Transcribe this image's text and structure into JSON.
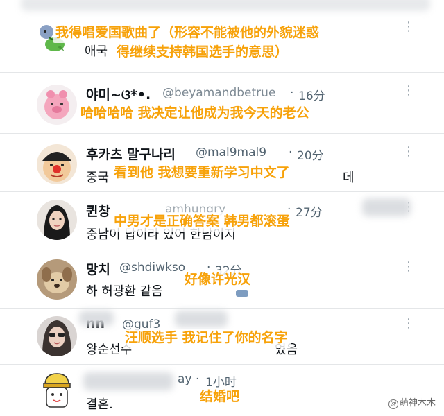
{
  "posts": [
    {
      "id": "p0",
      "name": "",
      "handle": "",
      "time": "",
      "body": "애국",
      "caption_lines": [
        "我得唱爱国歌曲了（形容不能被他的外貌迷惑",
        "得继续支持韩国选手的意思）"
      ],
      "avatar_icon": "dinosaur-cartoon-avatar"
    },
    {
      "id": "p1",
      "name": "야미~ଓ*•.",
      "handle": "@beyamandbetrue",
      "time": "16分",
      "body": "",
      "caption_lines": [
        "哈哈哈哈 我决定让他成为我今天的老公"
      ],
      "avatar_icon": "pink-pig-avatar"
    },
    {
      "id": "p2",
      "name": "후카츠 말구나리",
      "handle": "@mal9mal9",
      "time": "20分",
      "body": "중국",
      "body_tail": "데",
      "caption_lines": [
        "看到他 我想要重新学习中文了"
      ],
      "avatar_icon": "clown-face-avatar"
    },
    {
      "id": "p3",
      "name": "퀸창",
      "handle": "amhungry",
      "time": "27分",
      "body": "중남이 답이라 있어 한남이지",
      "caption_lines": [
        "中男才是正确答案 韩男都滚蛋"
      ],
      "avatar_icon": "woman-portrait-avatar"
    },
    {
      "id": "p4",
      "name": "망치",
      "handle": "@shdiwkso",
      "time": "32分",
      "body": "하 허광환 같음",
      "caption_lines": [
        "好像许光汉"
      ],
      "avatar_icon": "dog-photo-avatar"
    },
    {
      "id": "p5",
      "name": "nn",
      "handle": "@guf3",
      "time": "",
      "body": "왕순선수",
      "body_tail": "었음",
      "caption_lines": [
        "汪顺选手 我记住了你的名字"
      ],
      "avatar_icon": "sunglasses-woman-avatar"
    },
    {
      "id": "p6",
      "name": "",
      "handle": "ay",
      "time": "1小时",
      "body": "결혼.",
      "caption_lines": [
        "结婚吧"
      ],
      "avatar_icon": "chef-hat-cartoon-avatar"
    }
  ],
  "more_icon": "more-dots-icon",
  "watermark": {
    "icon": "at-icon",
    "text": "萌神木木"
  },
  "colors": {
    "caption": "#f7a20a",
    "handle": "#536471",
    "separator": "#e4e6e8"
  }
}
